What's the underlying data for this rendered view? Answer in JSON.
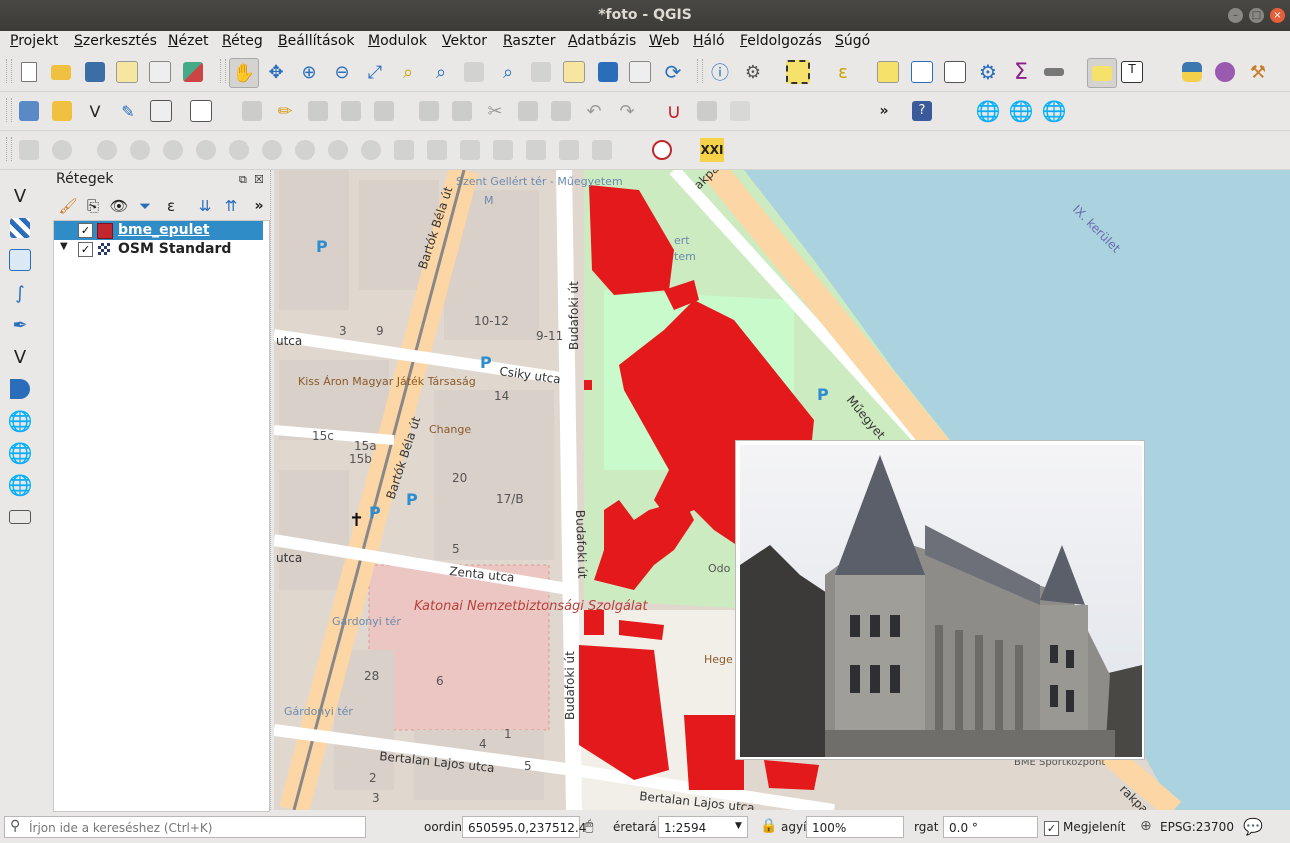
{
  "window": {
    "title": "*foto - QGIS"
  },
  "menu": [
    "Projekt",
    "Szerkesztés",
    "Nézet",
    "Réteg",
    "Beállítások",
    "Modulok",
    "Vektor",
    "Raszter",
    "Adatbázis",
    "Web",
    "Háló",
    "Feldolgozás",
    "Súgó"
  ],
  "toolbar": {
    "snapping_tolerance": "12",
    "more_label": "»",
    "label_tool": "XXI"
  },
  "layers_panel": {
    "title": "Rétegek",
    "more_label": "»",
    "layers": [
      {
        "name": "bme_epulet",
        "checked": true,
        "selected": true,
        "color": "#c1272d"
      },
      {
        "name": "OSM Standard",
        "checked": true,
        "selected": false
      }
    ]
  },
  "map": {
    "street_labels": [
      "Bartók Béla út",
      "Bartók Béla út",
      "Csiky utca",
      "Zenta utca",
      "Bertalan Lajos utca",
      "Bertalan Lajos utca",
      "Budafoki út",
      "Budafoki út",
      "Budafoki út",
      "Műegyet",
      "akpart",
      "IX. kerület",
      "utca",
      "utca",
      "rakpart"
    ],
    "poi_labels": [
      "Szent Gellért tér - Műegyetem",
      "Kiss Áron Magyar Játék Társaság",
      "Change",
      "Katonai Nemzetbiztonsági Szolgálat",
      "Gárdonyi tér",
      "Gárdonyi tér",
      "Odo",
      "Hege szob",
      "BME Sportközpont",
      "ert",
      "tem",
      "M"
    ],
    "house_numbers": [
      "3",
      "9",
      "10-12",
      "9-11",
      "14",
      "15c",
      "15a",
      "15b",
      "20",
      "17/B",
      "5",
      "28",
      "1",
      "2",
      "3",
      "4",
      "5",
      "6"
    ]
  },
  "status": {
    "search_placeholder": "Írjon ide a kereséshez (Ctrl+K)",
    "coord_label": "oordiná",
    "coord_value": "650595.0,237512.4",
    "scale_label": "éretará",
    "scale_value": "1:2594",
    "magnifier_label": "agyít",
    "magnifier_value": "100%",
    "rotation_label": "rgat",
    "rotation_value": "0.0 °",
    "render_label": "Megjelenít",
    "crs": "EPSG:23700"
  },
  "colors": {
    "building_fill": "#e3191c",
    "water": "#aad3df",
    "park": "#c8facc",
    "primary_road": "#fcd6a4",
    "selection": "#308cc6"
  }
}
